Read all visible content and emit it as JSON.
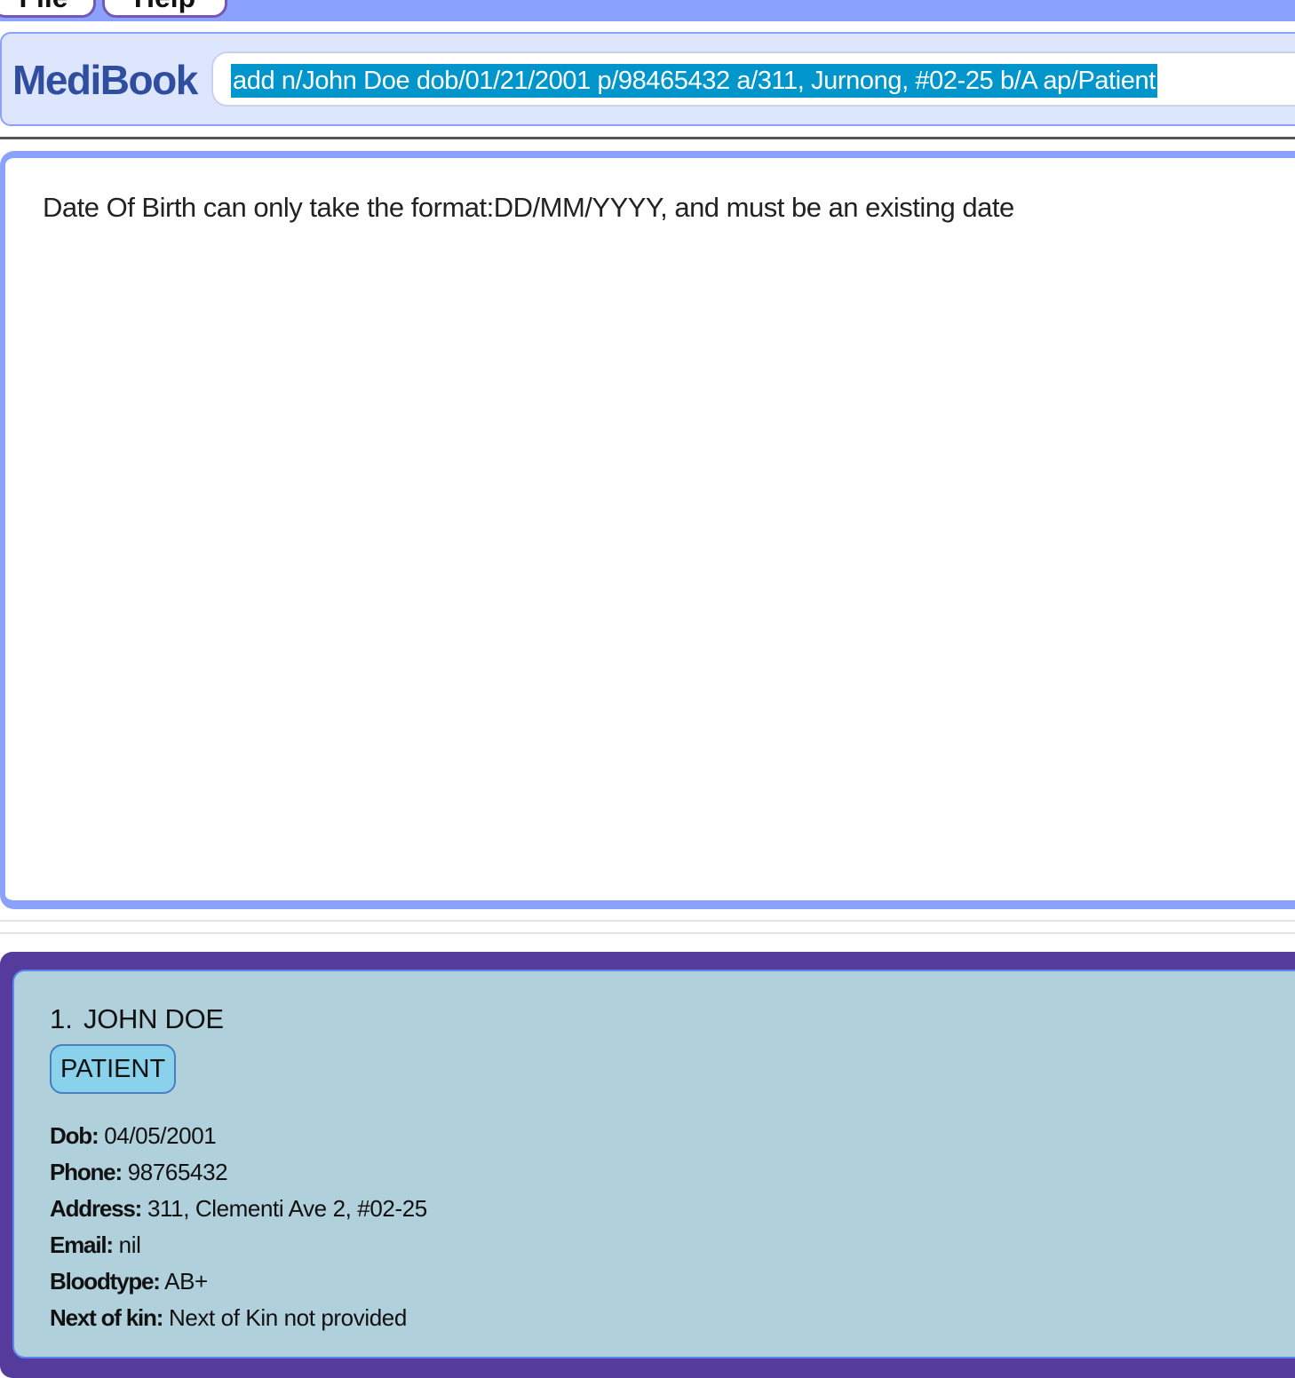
{
  "menu": {
    "file_label": "File",
    "help_label": "Help"
  },
  "app": {
    "title": "MediBook"
  },
  "command": {
    "value": "add n/John Doe dob/01/21/2001 p/98465432 a/311, Jurnong, #02-25 b/A ap/Patient"
  },
  "result": {
    "message": "Date Of Birth can only take the format:DD/MM/YYYY, and must be an existing date"
  },
  "persons": [
    {
      "index": "1.",
      "name": "JOHN DOE",
      "role": "PATIENT",
      "fields": [
        {
          "label": "Dob:",
          "value": "04/05/2001"
        },
        {
          "label": "Phone:",
          "value": "98765432"
        },
        {
          "label": "Address:",
          "value": "311, Clementi Ave 2, #02-25"
        },
        {
          "label": "Email:",
          "value": "nil"
        },
        {
          "label": "Bloodtype:",
          "value": "AB+"
        },
        {
          "label": "Next of kin:",
          "value": "Next of Kin not provided"
        }
      ]
    }
  ],
  "colors": {
    "menubar": "#8aa2fb",
    "brand": "#2f4ea0",
    "selection": "#0096cc",
    "list_panel": "#543b9c",
    "card": "#b0d0dc",
    "tag": "#8ad1ec"
  }
}
